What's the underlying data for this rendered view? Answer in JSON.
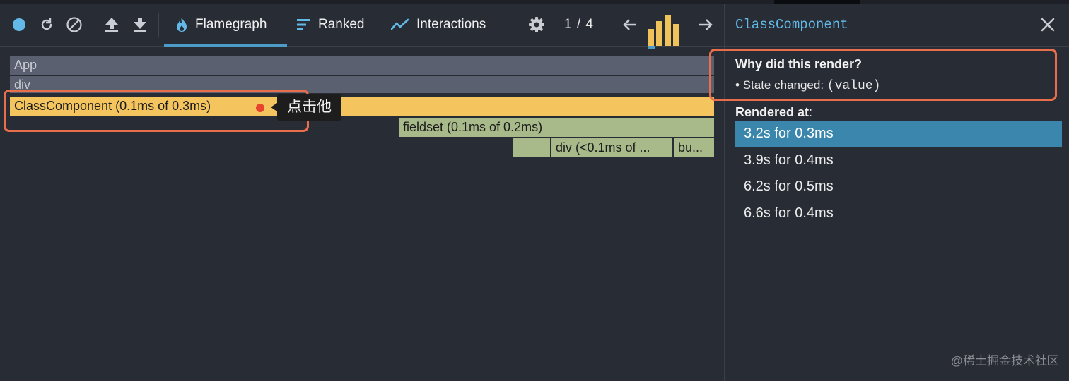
{
  "colors": {
    "background": "#282c34",
    "accent_blue": "#4d9cc8",
    "flame_yellow": "#f4c45e",
    "flame_green": "#a8b98a",
    "flame_gray": "#5b6070",
    "highlight_orange": "#e96f4c",
    "selected_row": "#3a86ad"
  },
  "toolbar": {
    "record_icon": "record-circle-icon",
    "reload_icon": "reload-icon",
    "clear_icon": "clear-icon",
    "upload_icon": "upload-icon",
    "download_icon": "download-icon",
    "tabs": [
      {
        "label": "Flamegraph",
        "icon": "flame-icon",
        "active": true
      },
      {
        "label": "Ranked",
        "icon": "ranked-icon",
        "active": false
      },
      {
        "label": "Interactions",
        "icon": "interactions-icon",
        "active": false
      }
    ],
    "settings_icon": "gear-icon",
    "commit_counter": "1 / 4",
    "prev_icon": "arrow-left-icon",
    "next_icon": "arrow-right-icon",
    "commit_bars": [
      0.55,
      0.8,
      1.0,
      0.7
    ]
  },
  "flamegraph": {
    "rows": [
      {
        "label": "App"
      },
      {
        "label": "div"
      },
      {
        "label": "ClassComponent (0.1ms of 0.3ms)"
      },
      {
        "label": "fieldset (0.1ms of 0.2ms)"
      },
      {
        "label": "div (<0.1ms of ...",
        "extra": "bu..."
      }
    ],
    "tooltip": "点击他"
  },
  "sidebar": {
    "title": "ClassComponent",
    "close_icon": "close-icon",
    "why_title": "Why did this render?",
    "why_prefix": "• State changed:",
    "why_value": "(value)",
    "rendered_label": "Rendered at",
    "rendered_colon": ":",
    "renders": [
      {
        "label": "3.2s for 0.3ms",
        "selected": true
      },
      {
        "label": "3.9s for 0.4ms",
        "selected": false
      },
      {
        "label": "6.2s for 0.5ms",
        "selected": false
      },
      {
        "label": "6.6s for 0.4ms",
        "selected": false
      }
    ]
  },
  "watermark": "@稀土掘金技术社区"
}
